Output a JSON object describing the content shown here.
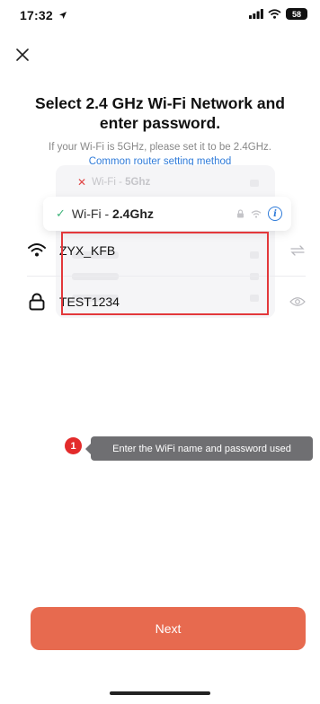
{
  "status_bar": {
    "time": "17:32",
    "battery": "58"
  },
  "header": {
    "title": "Select 2.4 GHz Wi-Fi Network and enter password.",
    "subtitle": "If your Wi-Fi is 5GHz, please set it to be 2.4GHz.",
    "link": "Common router setting method"
  },
  "illustration": {
    "wifi_5g_prefix": "Wi-Fi - ",
    "wifi_5g_band": "5Ghz",
    "wifi_24g_prefix": "Wi-Fi - ",
    "wifi_24g_band": "2.4Ghz",
    "info_glyph": "i"
  },
  "form": {
    "wifi_name": "ZYX_KFB",
    "password": "TEST1234"
  },
  "callout": {
    "number": "1",
    "text": "Enter the WiFi name and password used"
  },
  "buttons": {
    "next": "Next"
  },
  "colors": {
    "primary_button": "#e76a4f",
    "link": "#2f7bd9",
    "check": "#3fb47a",
    "error": "#e3383b"
  }
}
